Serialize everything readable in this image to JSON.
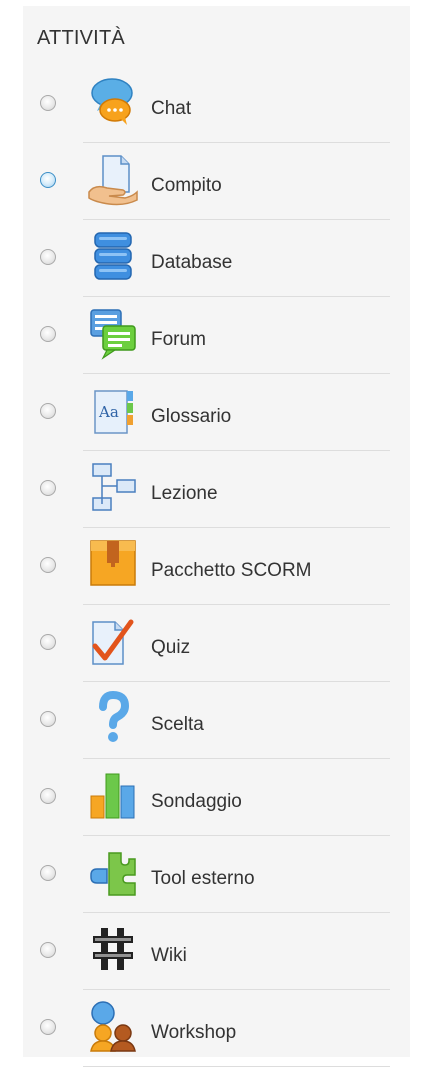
{
  "section": {
    "title": "ATTIVITÀ"
  },
  "activities": [
    {
      "label": "Chat",
      "icon": "chat-icon",
      "selected": false,
      "hovered": false
    },
    {
      "label": "Compito",
      "icon": "assignment-icon",
      "selected": false,
      "hovered": true
    },
    {
      "label": "Database",
      "icon": "database-icon",
      "selected": false,
      "hovered": false
    },
    {
      "label": "Forum",
      "icon": "forum-icon",
      "selected": false,
      "hovered": false
    },
    {
      "label": "Glossario",
      "icon": "glossary-icon",
      "selected": false,
      "hovered": false
    },
    {
      "label": "Lezione",
      "icon": "lesson-icon",
      "selected": false,
      "hovered": false
    },
    {
      "label": "Pacchetto SCORM",
      "icon": "scorm-package-icon",
      "selected": false,
      "hovered": false
    },
    {
      "label": "Quiz",
      "icon": "quiz-icon",
      "selected": false,
      "hovered": false
    },
    {
      "label": "Scelta",
      "icon": "choice-icon",
      "selected": false,
      "hovered": false
    },
    {
      "label": "Sondaggio",
      "icon": "feedback-icon",
      "selected": false,
      "hovered": false
    },
    {
      "label": "Tool esterno",
      "icon": "external-tool-icon",
      "selected": false,
      "hovered": false
    },
    {
      "label": "Wiki",
      "icon": "wiki-icon",
      "selected": false,
      "hovered": false
    },
    {
      "label": "Workshop",
      "icon": "workshop-icon",
      "selected": false,
      "hovered": false
    }
  ],
  "colors": {
    "panel_background": "#f5f5f5",
    "separator": "#dddddd",
    "text": "#333333",
    "radio_hover": "#3c8fc7"
  }
}
